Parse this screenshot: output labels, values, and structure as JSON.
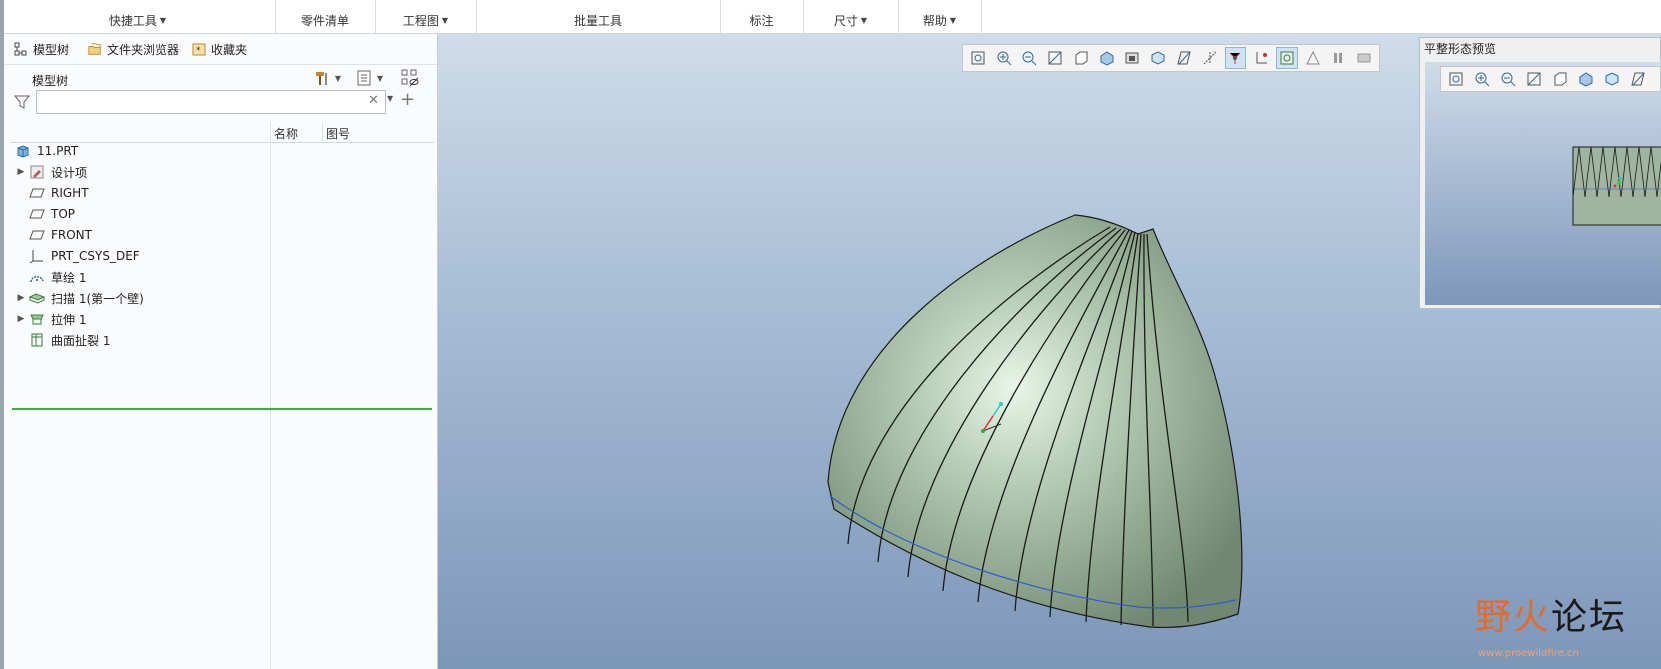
{
  "ribbon": {
    "groups": [
      {
        "label": "快捷工具",
        "dropdown": true
      },
      {
        "label": "零件清单",
        "dropdown": false
      },
      {
        "label": "工程图",
        "dropdown": true
      },
      {
        "label": "批量工具",
        "dropdown": false
      },
      {
        "label": "标注",
        "dropdown": false
      },
      {
        "label": "尺寸",
        "dropdown": true
      },
      {
        "label": "帮助",
        "dropdown": true
      }
    ]
  },
  "navigator": {
    "tabs": [
      {
        "label": "模型树",
        "icon": "model-tree-icon"
      },
      {
        "label": "文件夹浏览器",
        "icon": "folder-browser-icon"
      },
      {
        "label": "收藏夹",
        "icon": "favorites-icon"
      }
    ],
    "title": "模型树",
    "filter": {
      "value": "",
      "placeholder": ""
    },
    "columns": [
      "名称",
      "图号"
    ],
    "items": [
      {
        "label": "11.PRT",
        "icon": "part-icon",
        "expandable": false,
        "indent": 0
      },
      {
        "label": "设计项",
        "icon": "design-items-icon",
        "expandable": true,
        "indent": 1
      },
      {
        "label": "RIGHT",
        "icon": "datum-plane-icon",
        "expandable": false,
        "indent": 1
      },
      {
        "label": "TOP",
        "icon": "datum-plane-icon",
        "expandable": false,
        "indent": 1
      },
      {
        "label": "FRONT",
        "icon": "datum-plane-icon",
        "expandable": false,
        "indent": 1
      },
      {
        "label": "PRT_CSYS_DEF",
        "icon": "csys-icon",
        "expandable": false,
        "indent": 1
      },
      {
        "label": "草绘 1",
        "icon": "sketch-icon",
        "expandable": false,
        "indent": 1
      },
      {
        "label": "扫描 1(第一个壁)",
        "icon": "sweep-icon",
        "expandable": true,
        "indent": 1
      },
      {
        "label": "拉伸 1",
        "icon": "extrude-icon",
        "expandable": true,
        "indent": 1
      },
      {
        "label": "曲面扯裂 1",
        "icon": "surface-rip-icon",
        "expandable": false,
        "indent": 1
      }
    ]
  },
  "preview": {
    "title": "平整形态预览"
  },
  "watermark": {
    "text_a": "野火",
    "text_b": "论坛",
    "sub": "www.proewildfire.cn"
  },
  "colors": {
    "accent": "#3fae3f",
    "model_fill": "#9fb59f",
    "viewport_top": "#cfdcea",
    "viewport_bottom": "#7d97b9"
  }
}
